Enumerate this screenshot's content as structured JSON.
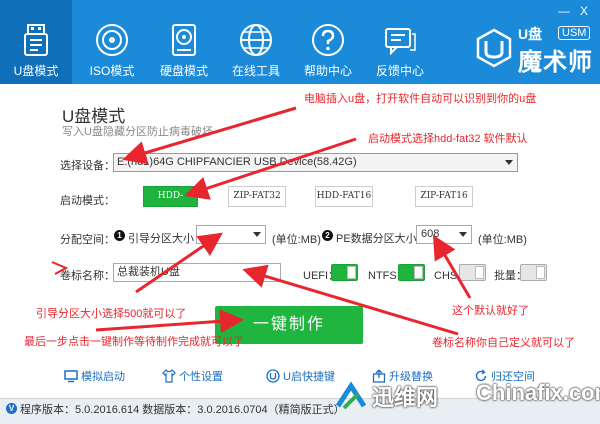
{
  "window": {
    "minimize": "—",
    "close": "X"
  },
  "tabs": [
    {
      "label": "U盘模式",
      "icon": "usb-drive-icon",
      "active": true
    },
    {
      "label": "ISO模式",
      "icon": "disc-icon",
      "active": false
    },
    {
      "label": "硬盘模式",
      "icon": "hard-disk-icon",
      "active": false
    },
    {
      "label": "在线工具",
      "icon": "globe-icon",
      "active": false
    },
    {
      "label": "帮助中心",
      "icon": "help-icon",
      "active": false
    },
    {
      "label": "反馈中心",
      "icon": "feedback-icon",
      "active": false
    }
  ],
  "logo": {
    "line1": "U盘",
    "badge": "USM",
    "line2": "魔术师"
  },
  "main": {
    "title": "U盘模式",
    "subtitle": "写入U盘隐藏分区防止病毒破坏",
    "device_label": "选择设备：",
    "device_value": "E:(hd1)64G CHIPFANCIER USB Device(58.42G)",
    "boot_mode_label": "启动模式：",
    "boot_modes": [
      "HDD-FAT32",
      "ZIP-FAT32",
      "HDD-FAT16",
      "ZIP-FAT16"
    ],
    "partition_label": "分配空间：",
    "boot_part_num": "1",
    "boot_part_label": "引导分区大小：",
    "boot_part_value": "",
    "boot_part_unit": "(单位:MB)",
    "pe_part_num": "2",
    "pe_part_label": "PE数据分区大小：",
    "pe_part_value": "608",
    "pe_part_unit": "(单位:MB)",
    "volume_label": "卷标名称：",
    "volume_value": "总裁装机U盘",
    "uefi_label": "UEFI：",
    "ntfs_label": "NTFS：",
    "chs_label": "CHS：",
    "batch_label": "批量：",
    "make_button": "一键制作"
  },
  "bottom_links": [
    {
      "label": "模拟启动",
      "icon": "monitor-icon"
    },
    {
      "label": "个性设置",
      "icon": "shirt-icon"
    },
    {
      "label": "U启快捷键",
      "icon": "u-circle-icon"
    },
    {
      "label": "升级替换",
      "icon": "upgrade-icon"
    },
    {
      "label": "归还空间",
      "icon": "refresh-icon"
    }
  ],
  "status": {
    "icon_letter": "V",
    "text": "程序版本：5.0.2016.614  数据版本：3.0.2016.0704（精简版正式）"
  },
  "annotations": {
    "a1": "电脑插入u盘，打开软件自动可以识别到你的u盘",
    "a2": "启动模式选择hdd-fat32  软件默认",
    "a3": "引导分区大小选择500就可以了",
    "a4": "最后一步点击一键制作等待制作完成就可以了",
    "a5": "这个默认就好了",
    "a6": "卷标名称你自己定义就可以了"
  },
  "watermark": {
    "brand_cn": "迅维网",
    "brand_en": "Chinafix.com"
  },
  "colors": {
    "header": "#1b8ad8",
    "accent_green": "#1db33c",
    "annotation": "#e8262d",
    "link": "#1b6fc4"
  }
}
